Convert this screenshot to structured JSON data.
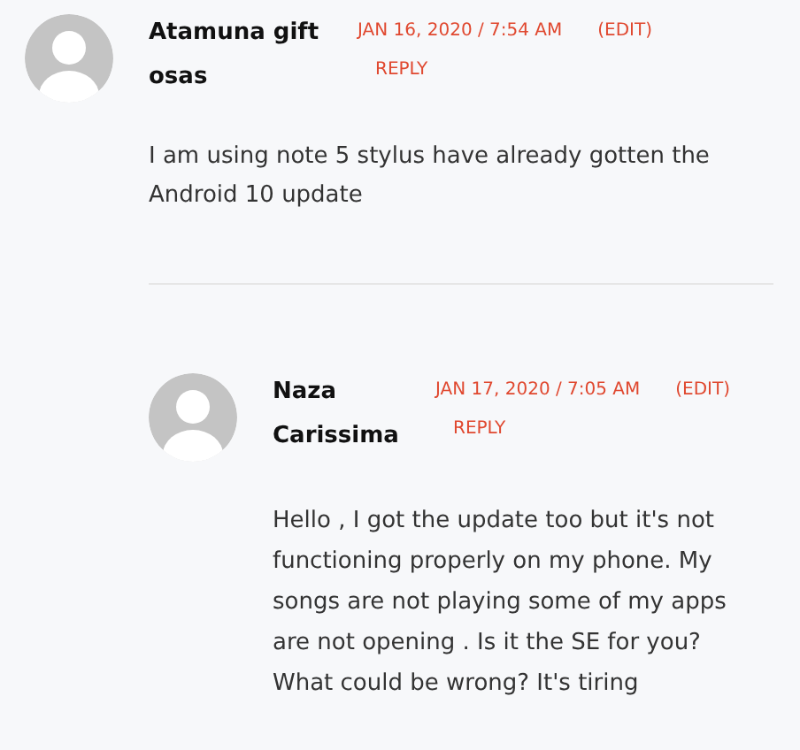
{
  "comments": [
    {
      "author": "Atamuna gift osas",
      "date": "JAN 16, 2020 / 7:54 AM",
      "edit": "(EDIT)",
      "reply": "REPLY",
      "text": "I am using note 5 stylus have already gotten the Android 10 update",
      "children": [
        {
          "author": "Naza Carissima",
          "date": "JAN 17, 2020 / 7:05 AM",
          "edit": "(EDIT)",
          "reply": "REPLY",
          "text": "Hello , I got the update too but it's not functioning properly on my phone. My songs are not playing some of my apps are not opening . Is it the SE for you? What could be wrong? It's tiring"
        }
      ]
    }
  ]
}
